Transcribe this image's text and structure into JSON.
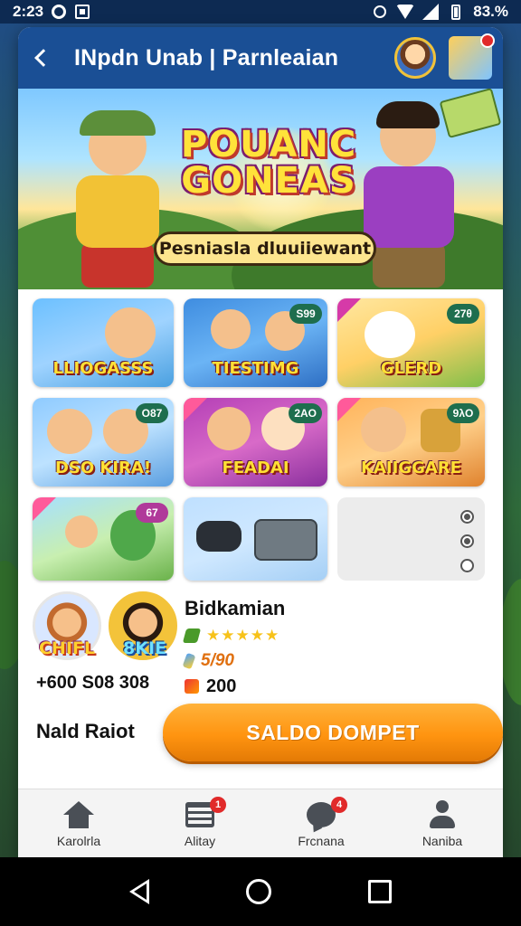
{
  "status_bar": {
    "time": "2:23",
    "battery": "83.%",
    "icons": [
      "sync-icon",
      "gallery-icon",
      "alarm-icon",
      "wifi-icon",
      "signal-icon",
      "battery-icon"
    ]
  },
  "header": {
    "title": "INpdn Unab | Parnleaian",
    "back_icon": "chevron-left-icon"
  },
  "hero": {
    "title_line1": "POUANC",
    "title_line2": "GONEAS",
    "subtitle": "Pesniasla dluuiiewant"
  },
  "games": [
    {
      "label": "LLIOGASSS",
      "badge": ""
    },
    {
      "label": "TIESTIMG",
      "badge": "S99"
    },
    {
      "label": "GLERD",
      "badge": "27θ"
    },
    {
      "label": "DSO KIRA!",
      "badge": "O87"
    },
    {
      "label": "FEADAI",
      "badge": "2AO"
    },
    {
      "label": "KAIIGGARE",
      "badge": "9λO"
    },
    {
      "label": "",
      "badge": "67"
    },
    {
      "label": "",
      "badge": ""
    }
  ],
  "profile": {
    "char1_label": "CHIFL",
    "char2_label": "8KIE",
    "phone": "+600 S08 308",
    "name": "Bidkamian",
    "stars": "★★★★★",
    "value_orange": "5/90",
    "value_count": "200"
  },
  "wallet": {
    "label": "Nald Raiot",
    "button": "SALDO DOMPET"
  },
  "bottom_nav": [
    {
      "label": "Karolrla",
      "icon": "home-icon",
      "badge": ""
    },
    {
      "label": "Alitay",
      "icon": "list-icon",
      "badge": "1"
    },
    {
      "label": "Frcnana",
      "icon": "chat-icon",
      "badge": "4"
    },
    {
      "label": "Naniba",
      "icon": "person-icon",
      "badge": ""
    }
  ],
  "colors": {
    "header": "#1a4f95",
    "wallet_button": "#ff9410",
    "badge": "#e12a2a"
  }
}
